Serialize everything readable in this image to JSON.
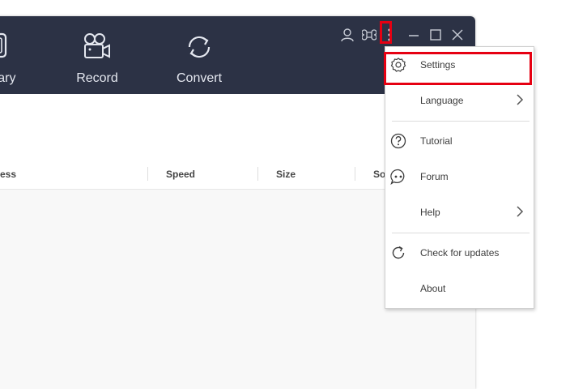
{
  "nav": {
    "library_label": "Library",
    "record_label": "Record",
    "convert_label": "Convert"
  },
  "table": {
    "headers": [
      "Progress",
      "Speed",
      "Size",
      "Source"
    ]
  },
  "menu": {
    "items": [
      {
        "label": "Settings",
        "icon": "gear-icon"
      },
      {
        "label": "Language",
        "icon": "chevron-right-icon"
      },
      {
        "label": "Tutorial",
        "icon": "question-circle-icon"
      },
      {
        "label": "Forum",
        "icon": "chat-bubble-icon"
      },
      {
        "label": "Help",
        "icon": "chevron-right-icon"
      },
      {
        "label": "Check for updates",
        "icon": "refresh-icon"
      },
      {
        "label": "About",
        "icon": ""
      }
    ]
  },
  "colors": {
    "topbar": "#2c3245",
    "highlight": "#e60012"
  }
}
